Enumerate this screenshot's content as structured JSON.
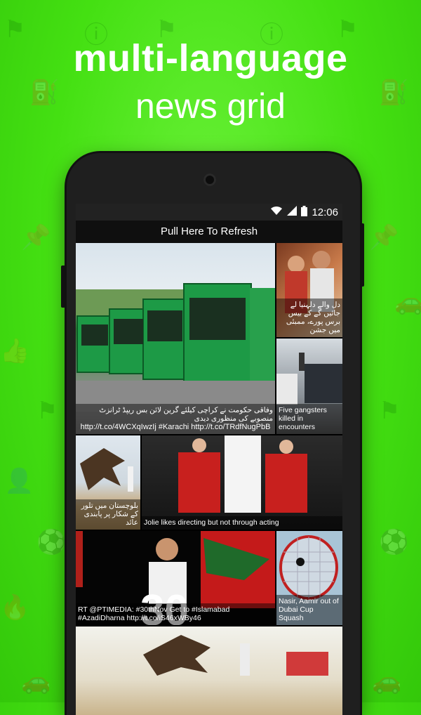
{
  "headline": {
    "line1": "multi-language",
    "line2": "news grid"
  },
  "status_bar": {
    "time": "12:06"
  },
  "refresh_label": "Pull Here To Refresh",
  "tiles": [
    {
      "caption": "وفاقی حکومت نے کراچی کیلئے گرین لائن بس ریپڈ ٹرانزٹ منصوبے کی منظوری دیدی",
      "caption2": "http://t.co/4WCXqIwzIj #Karachi http://t.co/TRdfNugPbB"
    },
    {
      "caption": "دل والے دلہنیا لے جائیں گے کے بیس برس پورے، ممبئی میں جشن"
    },
    {
      "caption": "Five gangsters killed in encounters"
    },
    {
      "caption": "بلوچستان میں تلور کے شکار پر پابندی عائد"
    },
    {
      "caption": "Jolie likes directing but not through acting"
    },
    {
      "caption": "RT @PTIMEDIA: #30thNov Get to #Islamabad #AzadiDharna http://t.co/iS46xWBy46"
    },
    {
      "caption": "Nasir, Aamir out of Dubai Cup Squash"
    },
    {
      "caption": ""
    }
  ],
  "icons": [
    "wifi-icon",
    "signal-icon",
    "battery-icon"
  ]
}
